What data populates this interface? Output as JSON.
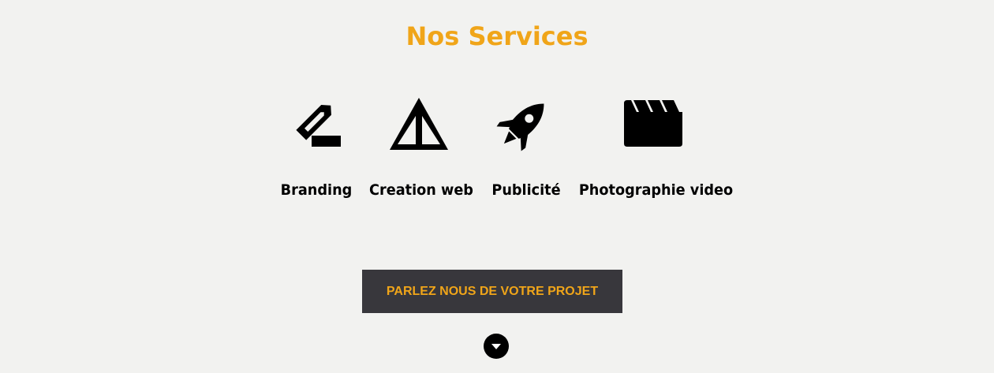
{
  "section": {
    "title": "Nos Services"
  },
  "services": [
    {
      "label": "Branding",
      "icon": "pencil-icon"
    },
    {
      "label": "Creation web",
      "icon": "triangle-icon"
    },
    {
      "label": "Publicité",
      "icon": "rocket-icon"
    },
    {
      "label": "Photographie video",
      "icon": "clapperboard-icon"
    }
  ],
  "cta": {
    "label": "PARLEZ NOUS DE VOTRE PROJET"
  },
  "scroll": {
    "icon": "arrow-down-circle-icon"
  },
  "colors": {
    "accent": "#f0a519",
    "background": "#f2f2f0",
    "button": "#38373c",
    "text": "#000000"
  }
}
